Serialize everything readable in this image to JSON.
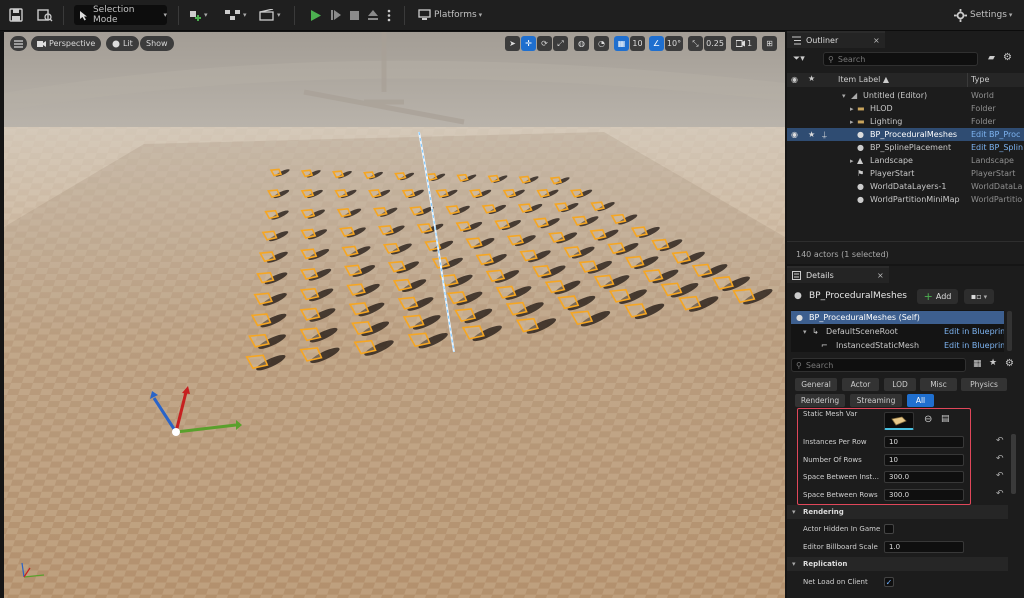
{
  "toolbar": {
    "mode_label": "Selection Mode",
    "platforms_label": "Platforms",
    "settings_label": "Settings"
  },
  "viewport": {
    "perspective_label": "Perspective",
    "lit_label": "Lit",
    "show_label": "Show",
    "grid_snap": "10",
    "rotation_snap": "10°",
    "scale_snap": "0.25",
    "camera_speed": "1"
  },
  "outliner": {
    "tab_label": "Outliner",
    "search_placeholder": "Search",
    "col_label": "Item Label ▲",
    "col_type": "Type",
    "items": [
      {
        "label": "Untitled (Editor)",
        "type": "World"
      },
      {
        "label": "HLOD",
        "type": "Folder"
      },
      {
        "label": "Lighting",
        "type": "Folder"
      },
      {
        "label": "BP_ProceduralMeshes",
        "type": "Edit BP_Proc"
      },
      {
        "label": "BP_SplinePlacement",
        "type": "Edit BP_Splin"
      },
      {
        "label": "Landscape",
        "type": "Landscape"
      },
      {
        "label": "PlayerStart",
        "type": "PlayerStart"
      },
      {
        "label": "WorldDataLayers-1",
        "type": "WorldDataLa"
      },
      {
        "label": "WorldPartitionMiniMap",
        "type": "WorldPartitio"
      }
    ],
    "status": "140 actors (1 selected)"
  },
  "details": {
    "tab_label": "Details",
    "actor_name": "BP_ProceduralMeshes",
    "add_label": "Add",
    "components": [
      {
        "label": "BP_ProceduralMeshes (Self)",
        "link": ""
      },
      {
        "label": "DefaultSceneRoot",
        "link": "Edit in Blueprint"
      },
      {
        "label": "InstancedStaticMesh",
        "link": "Edit in Blueprint"
      }
    ],
    "search_placeholder": "Search",
    "categories_row1": [
      "General",
      "Actor",
      "LOD",
      "Misc",
      "Physics"
    ],
    "categories_row2": [
      "Rendering",
      "Streaming",
      "All"
    ],
    "props": {
      "static_mesh_var": "Static Mesh Var",
      "instances_per_row": {
        "label": "Instances Per Row",
        "value": "10"
      },
      "number_of_rows": {
        "label": "Number Of Rows",
        "value": "10"
      },
      "space_between_inst": {
        "label": "Space Between Inst...",
        "value": "300.0"
      },
      "space_between_rows": {
        "label": "Space Between Rows",
        "value": "300.0"
      }
    },
    "rendering": {
      "section": "Rendering",
      "actor_hidden": "Actor Hidden In Game",
      "billboard_scale": {
        "label": "Editor Billboard Scale",
        "value": "1.0"
      }
    },
    "replication": {
      "section": "Replication",
      "net_load": "Net Load on Client"
    }
  },
  "colors": {
    "accent": "#1f6fcf",
    "highlight_box": "#e0475a",
    "selection": "#2f4c72",
    "mesh_outline": "#f5a623"
  }
}
